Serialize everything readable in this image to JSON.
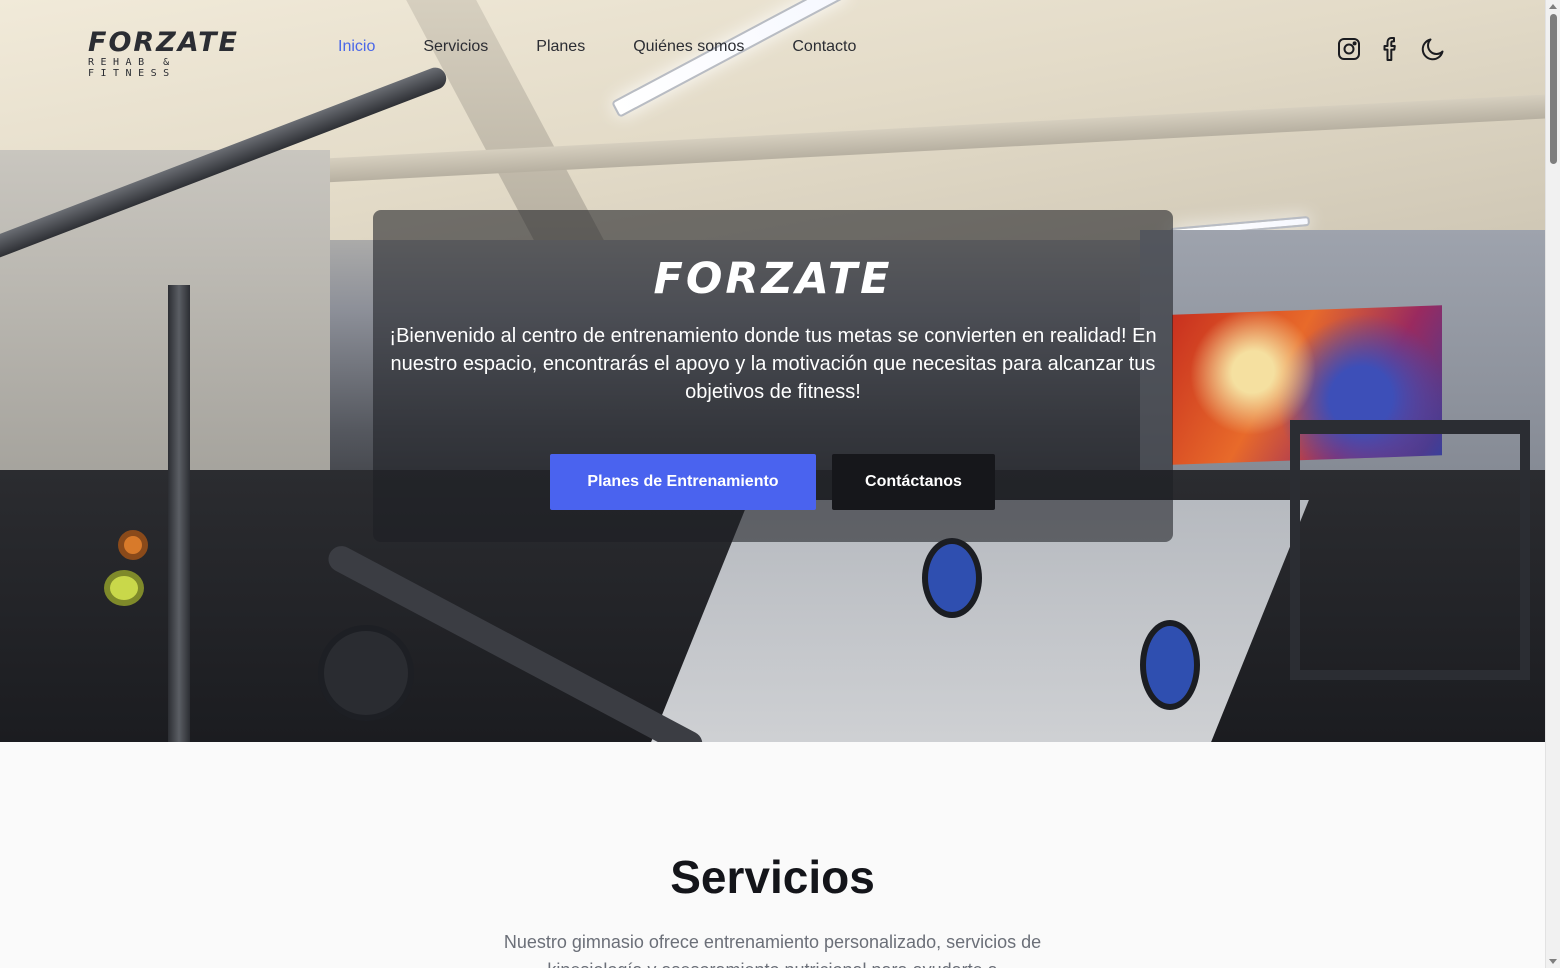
{
  "brand": {
    "logo_main": "FORZATE",
    "logo_sub": "REHAB & FITNESS",
    "accent_color": "#4a63ef",
    "dark_color": "#16171b"
  },
  "nav": {
    "links": [
      {
        "label": "Inicio",
        "active": true
      },
      {
        "label": "Servicios",
        "active": false
      },
      {
        "label": "Planes",
        "active": false
      },
      {
        "label": "Quiénes somos",
        "active": false
      },
      {
        "label": "Contacto",
        "active": false
      }
    ],
    "icons": [
      "instagram-icon",
      "facebook-icon",
      "moon-icon"
    ]
  },
  "hero": {
    "logo_text": "FORZATE",
    "text": "¡Bienvenido al centro de entrenamiento donde tus metas se convierten en realidad! En nuestro espacio, encontrarás el apoyo y la motivación que necesitas para alcanzar tus objetivos de fitness!",
    "primary_button": " Planes de Entrenamiento",
    "secondary_button": "Contáctanos"
  },
  "services": {
    "title": "Servicios",
    "description": "Nuestro gimnasio ofrece entrenamiento personalizado, servicios de kinesiología y asesoramiento nutricional para ayudarte a"
  }
}
